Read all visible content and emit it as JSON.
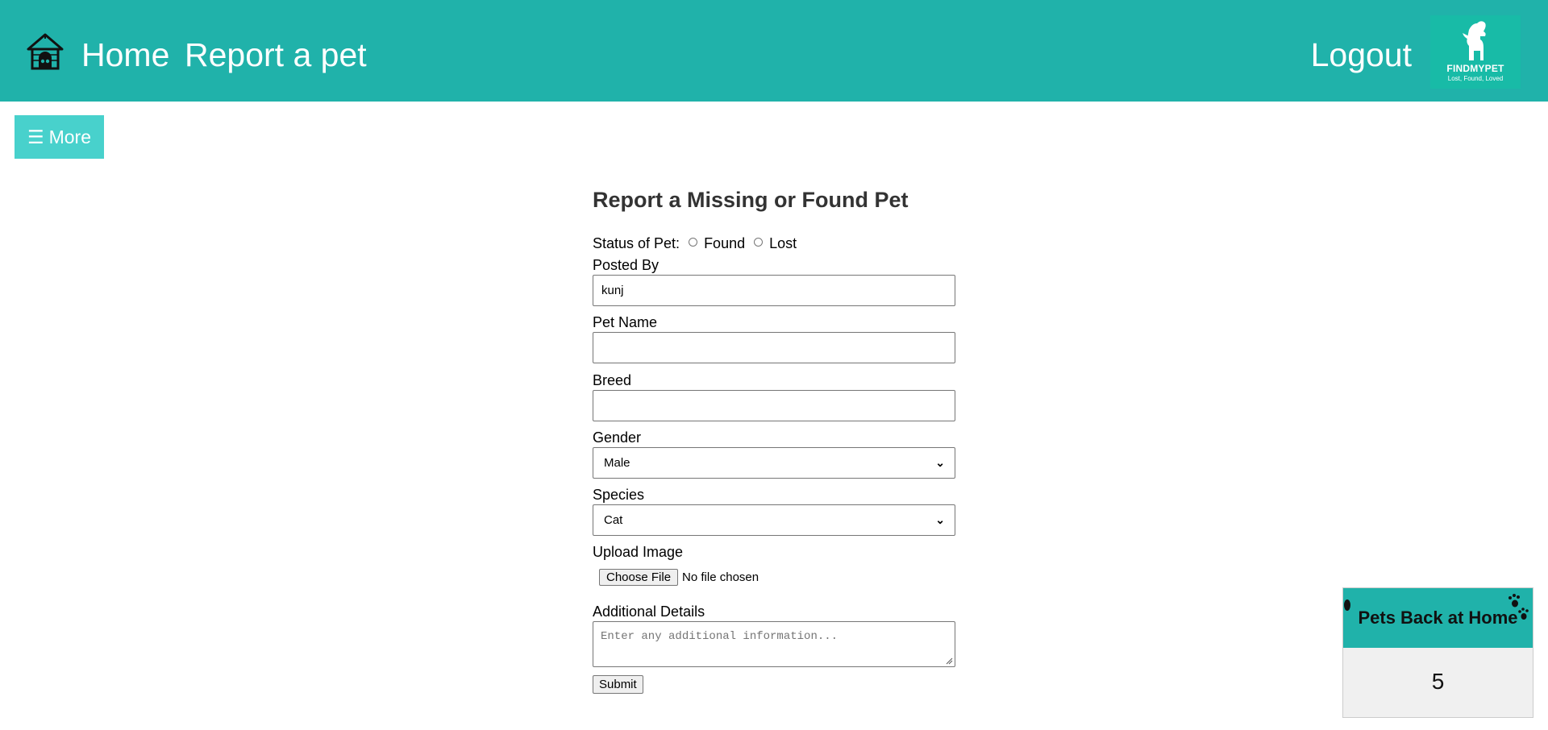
{
  "nav": {
    "home_label": "Home",
    "report_label": "Report a pet",
    "logout_label": "Logout",
    "logo_name": "FINDMYPET",
    "logo_tagline": "Lost, Found, Loved"
  },
  "more_button": {
    "icon": "hamburger-icon",
    "label": "More"
  },
  "form": {
    "title": "Report a Missing or Found Pet",
    "status_label": "Status of Pet:",
    "status_options": [
      "Found",
      "Lost"
    ],
    "posted_by": {
      "label": "Posted By",
      "value": "kunj"
    },
    "pet_name": {
      "label": "Pet Name",
      "value": ""
    },
    "breed": {
      "label": "Breed",
      "value": ""
    },
    "gender": {
      "label": "Gender",
      "selected": "Male"
    },
    "species": {
      "label": "Species",
      "selected": "Cat"
    },
    "upload": {
      "label": "Upload Image",
      "button": "Choose File",
      "status": "No file chosen"
    },
    "details": {
      "label": "Additional Details",
      "placeholder": "Enter any additional information..."
    },
    "submit_label": "Submit"
  },
  "widget": {
    "title": "Pets Back at Home",
    "count": "5"
  },
  "colors": {
    "header": "#20b2aa",
    "more_button": "#48d1cc",
    "logo_bg": "#18bba7",
    "widget_body": "#f0f0f0"
  }
}
